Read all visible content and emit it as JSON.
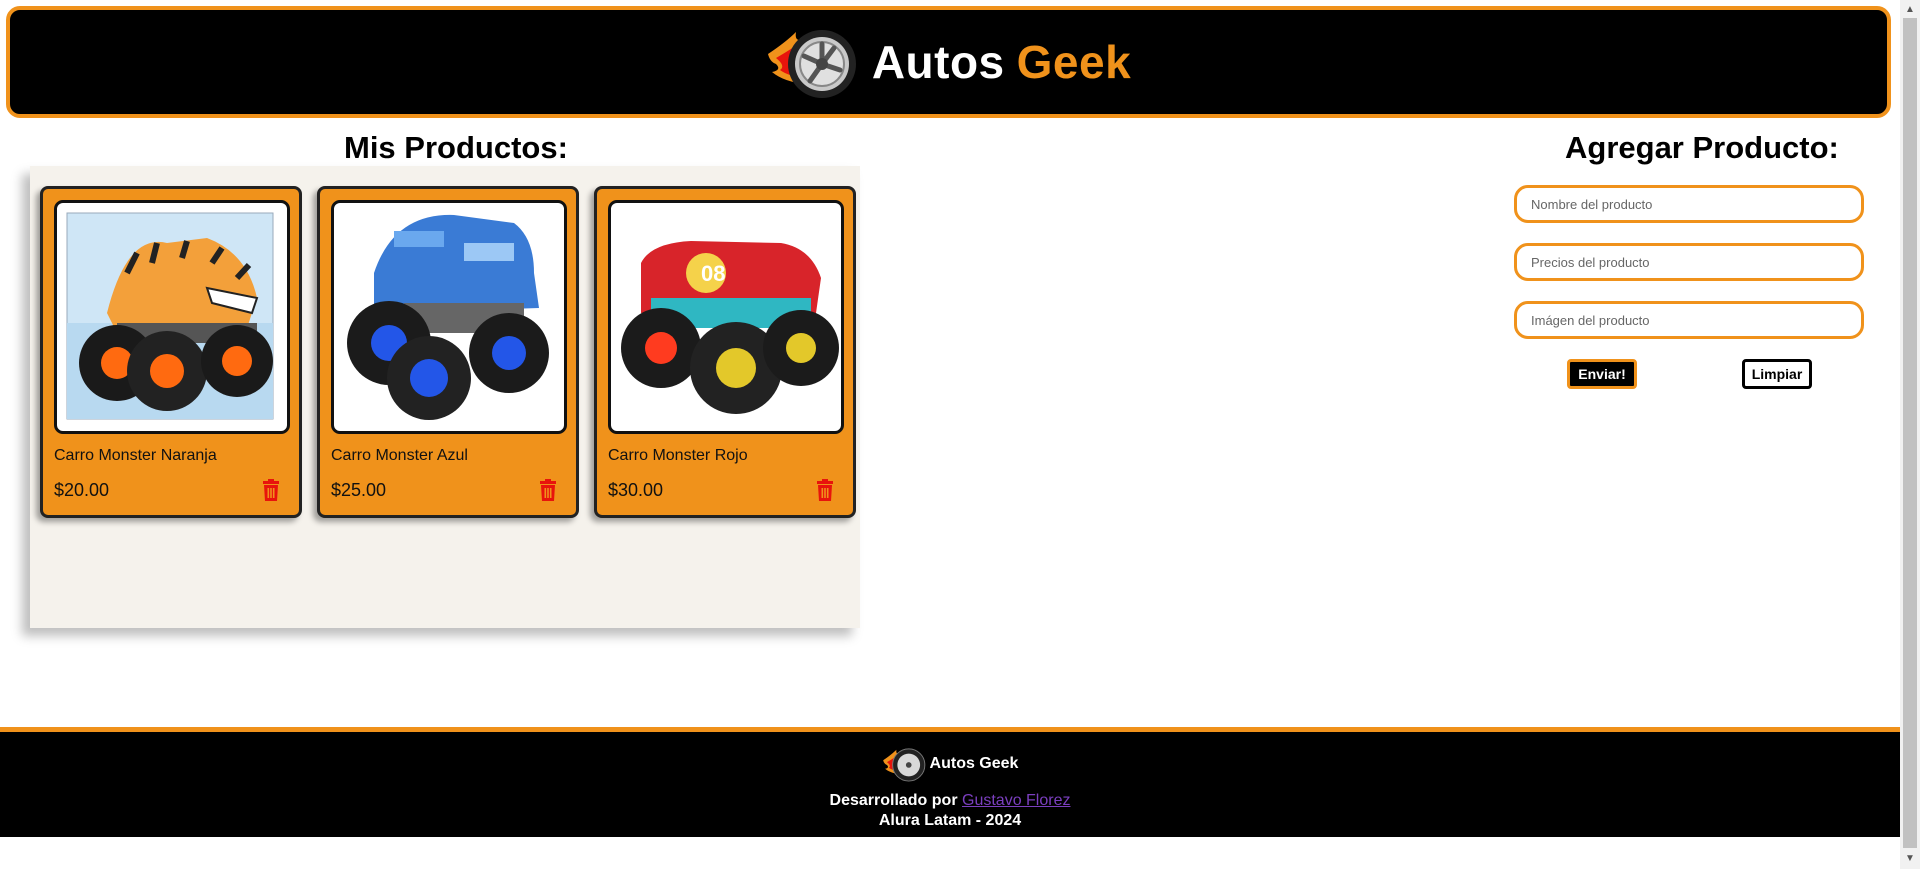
{
  "header": {
    "brand_main": "Autos",
    "brand_accent": "Geek"
  },
  "products_section": {
    "title": "Mis Productos:",
    "items": [
      {
        "name": "Carro Monster Naranja",
        "price": "$20.00",
        "image": "monster-truck-orange-shark"
      },
      {
        "name": "Carro Monster Azul",
        "price": "$25.00",
        "image": "monster-truck-blue"
      },
      {
        "name": "Carro Monster Rojo",
        "price": "$30.00",
        "image": "monster-truck-red"
      }
    ]
  },
  "form": {
    "title": "Agregar Producto:",
    "name_placeholder": "Nombre del producto",
    "price_placeholder": "Precios del producto",
    "image_placeholder": "Imágen del producto",
    "send_label": "Enviar!",
    "clear_label": "Limpiar"
  },
  "footer": {
    "brand": "Autos Geek",
    "dev_prefix": "Desarrollado por",
    "dev_name": "Gustavo Florez",
    "copyright": "Alura Latam - 2024"
  },
  "colors": {
    "accent": "#f0921b",
    "trash": "#e8140c",
    "link": "#7b3fbf"
  }
}
